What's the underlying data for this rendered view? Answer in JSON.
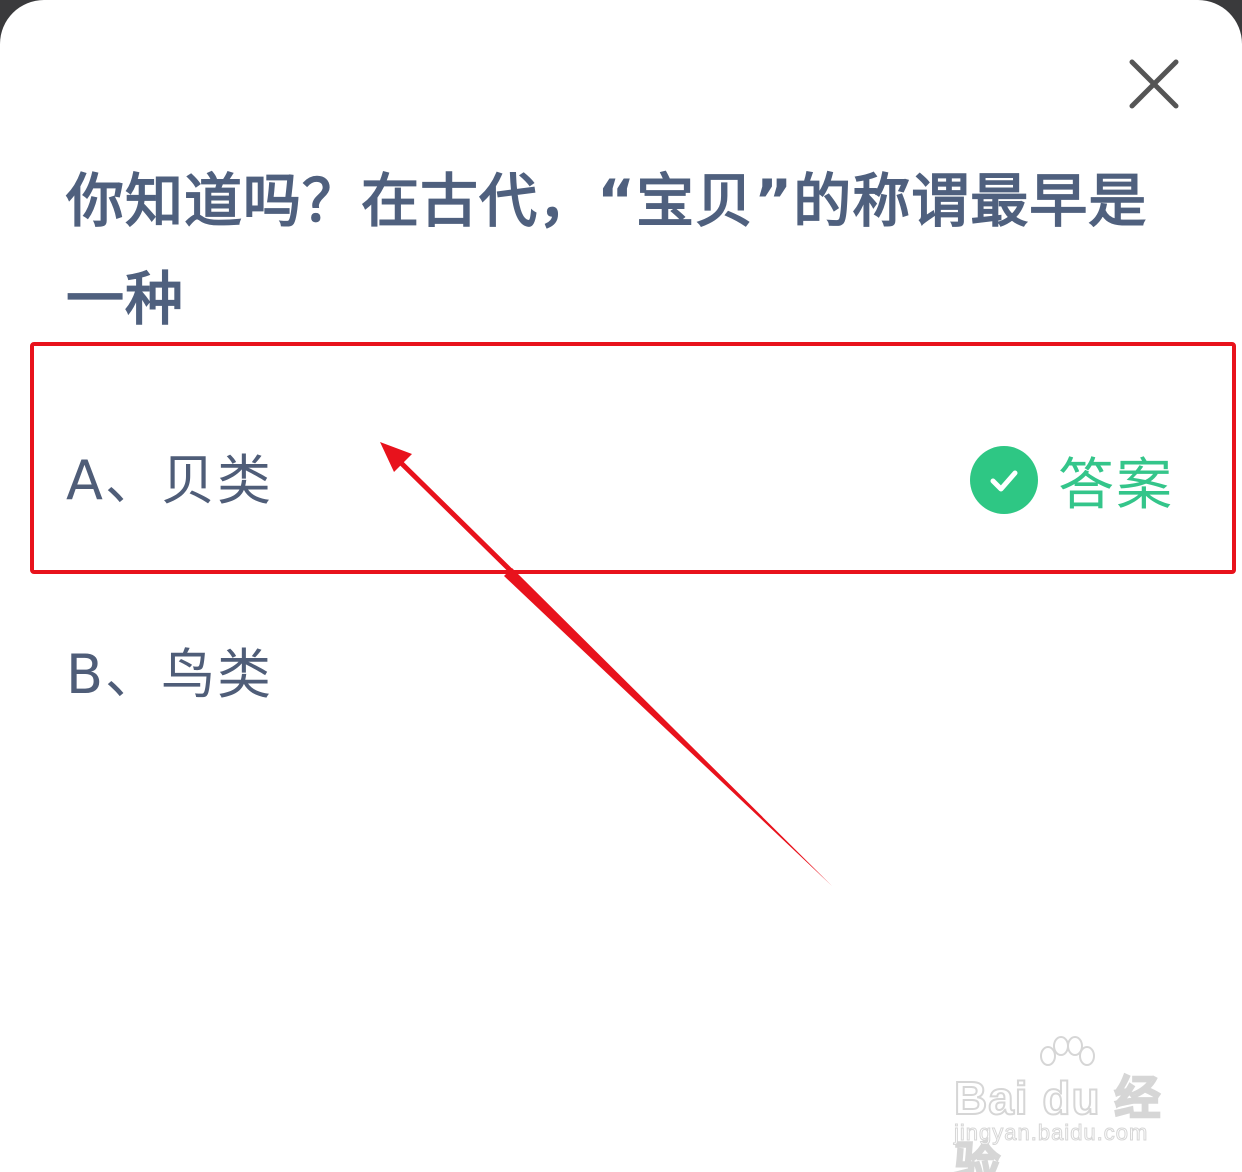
{
  "question": {
    "line1": "你知道吗？在古代，“宝贝”的称谓最早是",
    "line2": "一种"
  },
  "options": [
    {
      "label": "A、贝类",
      "is_answer": true,
      "answer_label": "答案"
    },
    {
      "label": "B、鸟类",
      "is_answer": false
    }
  ],
  "icons": {
    "close": "close-icon",
    "check": "check-circle-icon"
  },
  "colors": {
    "question_text": "#4f607e",
    "option_text": "#4f5d78",
    "answer_green": "#2ec784",
    "annotation_red": "#e8121c"
  },
  "watermark": {
    "brand": "Bai du 经验",
    "url": "jingyan.baidu.com"
  }
}
